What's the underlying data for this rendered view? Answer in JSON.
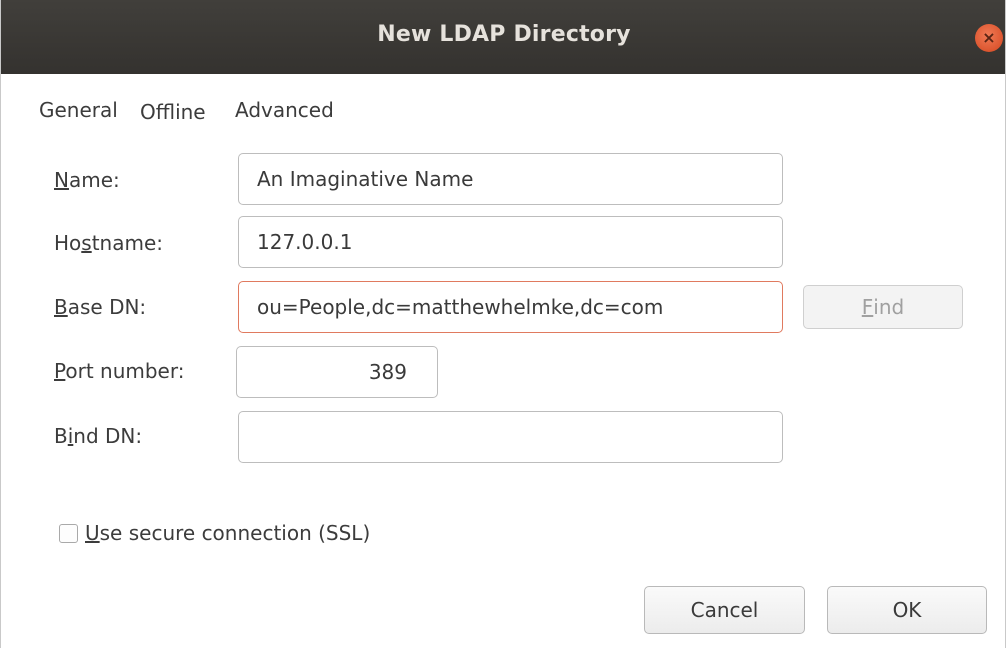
{
  "window": {
    "title": "New LDAP Directory",
    "close_glyph": "×"
  },
  "tabs": [
    {
      "label": "General"
    },
    {
      "label": "Offline"
    },
    {
      "label": "Advanced"
    }
  ],
  "form": {
    "name": {
      "label_mnemonic": "N",
      "label_rest": "ame:",
      "value": "An Imaginative Name"
    },
    "hostname": {
      "label_pre": "Ho",
      "label_mnemonic": "s",
      "label_rest": "tname:",
      "value": "127.0.0.1"
    },
    "base_dn": {
      "label_mnemonic": "B",
      "label_rest": "ase DN:",
      "value": "ou=People,dc=matthewhelmke,dc=com"
    },
    "port": {
      "label_mnemonic": "P",
      "label_rest": "ort number:",
      "value": "389"
    },
    "bind_dn": {
      "label_pre": "B",
      "label_mnemonic": "i",
      "label_rest": "nd DN:",
      "value": ""
    }
  },
  "find_button": {
    "mnemonic": "F",
    "rest": "ind"
  },
  "ssl": {
    "mnemonic": "U",
    "rest": "se secure connection (SSL)",
    "checked": false
  },
  "buttons": {
    "cancel": "Cancel",
    "ok": "OK"
  },
  "icons": {
    "close": "close-icon"
  }
}
